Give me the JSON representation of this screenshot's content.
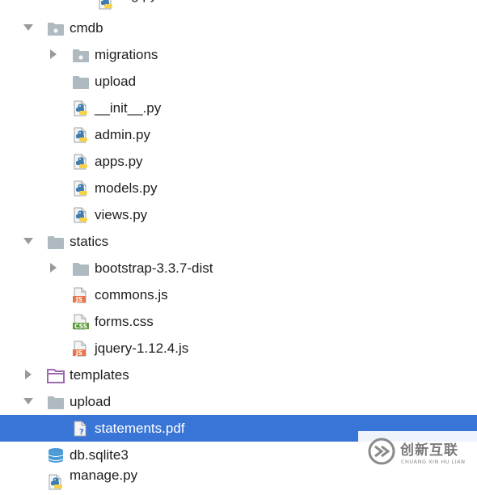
{
  "tree": {
    "rows": [
      {
        "label": "...g.py",
        "type": "python",
        "indent": 3,
        "arrow": "none",
        "partial": true
      },
      {
        "label": "cmdb",
        "type": "package",
        "indent": 1,
        "arrow": "expanded"
      },
      {
        "label": "migrations",
        "type": "package",
        "indent": 2,
        "arrow": "collapsed"
      },
      {
        "label": "upload",
        "type": "folder-gray",
        "indent": 2,
        "arrow": "none"
      },
      {
        "label": "__init__.py",
        "type": "python",
        "indent": 2,
        "arrow": "none"
      },
      {
        "label": "admin.py",
        "type": "python",
        "indent": 2,
        "arrow": "none"
      },
      {
        "label": "apps.py",
        "type": "python",
        "indent": 2,
        "arrow": "none"
      },
      {
        "label": "models.py",
        "type": "python",
        "indent": 2,
        "arrow": "none"
      },
      {
        "label": "views.py",
        "type": "python",
        "indent": 2,
        "arrow": "none"
      },
      {
        "label": "statics",
        "type": "folder-gray",
        "indent": 1,
        "arrow": "expanded"
      },
      {
        "label": "bootstrap-3.3.7-dist",
        "type": "folder-gray",
        "indent": 2,
        "arrow": "collapsed"
      },
      {
        "label": "commons.js",
        "type": "js",
        "indent": 2,
        "arrow": "none"
      },
      {
        "label": "forms.css",
        "type": "css",
        "indent": 2,
        "arrow": "none"
      },
      {
        "label": "jquery-1.12.4.js",
        "type": "js",
        "indent": 2,
        "arrow": "none"
      },
      {
        "label": "templates",
        "type": "folder-purple",
        "indent": 1,
        "arrow": "collapsed"
      },
      {
        "label": "upload",
        "type": "folder-gray",
        "indent": 1,
        "arrow": "expanded"
      },
      {
        "label": "statements.pdf",
        "type": "unknown",
        "indent": 2,
        "arrow": "none",
        "selected": true
      },
      {
        "label": "db.sqlite3",
        "type": "database",
        "indent": 1,
        "arrow": "none"
      },
      {
        "label": "manage.py",
        "type": "python",
        "indent": 1,
        "arrow": "none",
        "partial": true
      }
    ]
  },
  "icon_badges": {
    "js": "JS",
    "css": "CSS"
  },
  "colors": {
    "selection": "#3875d6",
    "folder_gray": "#aeb9c0",
    "folder_purple": "#9b6bae",
    "python_blue": "#3e7cb1",
    "python_yellow": "#f6d24a",
    "js_badge": "#e8764a",
    "css_badge": "#5c9a38",
    "database": "#4a9ad6"
  },
  "watermark": {
    "text": "创新互联",
    "subtext": "CHUANG XIN HU LIAN"
  }
}
